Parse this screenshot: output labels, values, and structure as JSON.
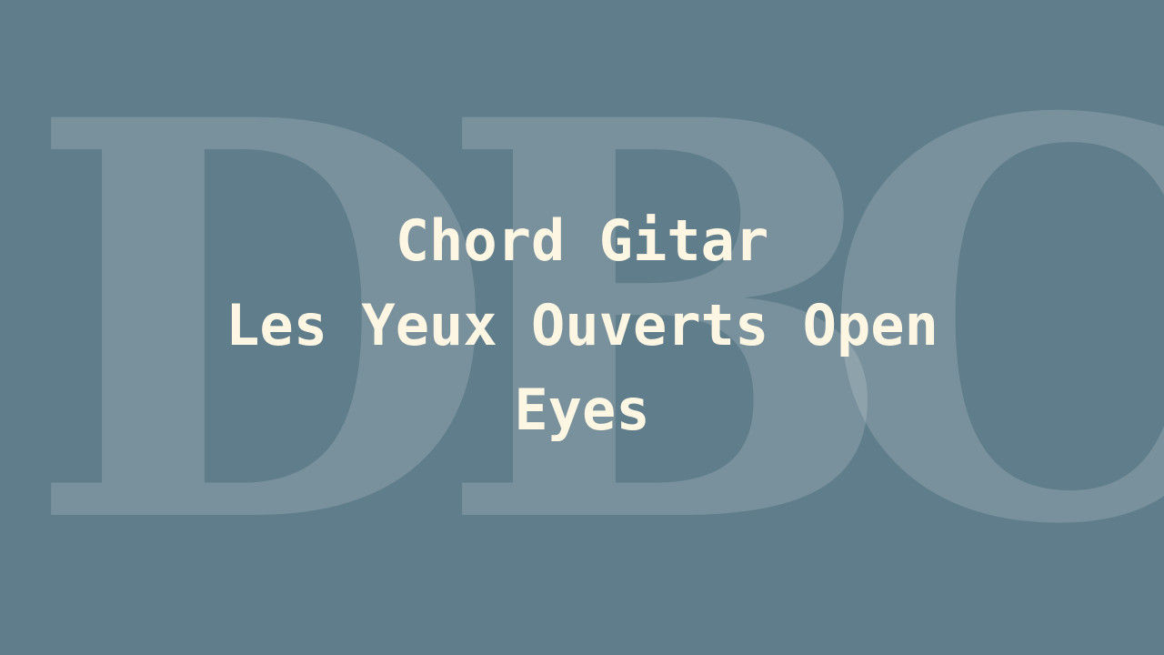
{
  "watermark": {
    "letters": [
      "D",
      "B",
      "C"
    ]
  },
  "title": {
    "line1": "Chord Gitar",
    "line2": "Les Yeux Ouverts Open",
    "line3": "Eyes"
  },
  "colors": {
    "background": "#607d8b",
    "title_text": "#fdf6e3"
  }
}
